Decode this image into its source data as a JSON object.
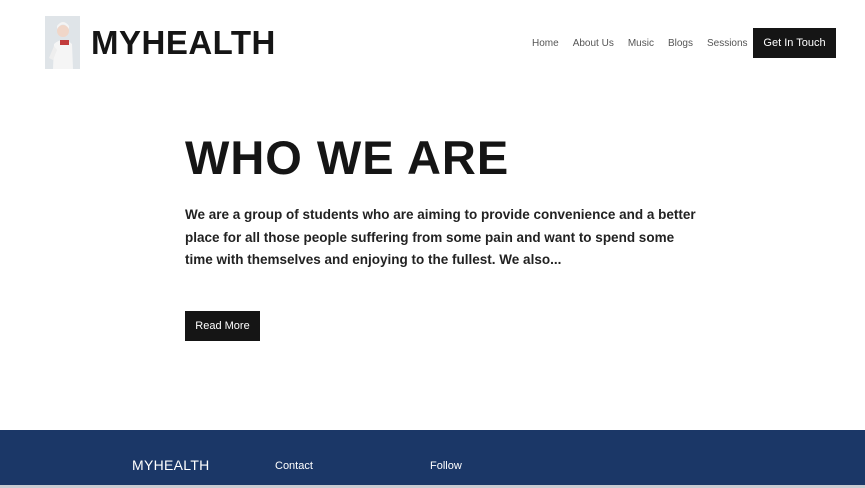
{
  "header": {
    "logo_icon": "person-photo",
    "title": "MYHEALTH",
    "nav": [
      "Home",
      "About Us",
      "Music",
      "Blogs",
      "Sessions"
    ],
    "cta_label": "Get In Touch"
  },
  "hero": {
    "title": "WHO WE ARE",
    "text": "We are a group of students who are aiming to provide convenience and a better place for all those people suffering from some pain and want to spend some time with themselves and enjoying to the fullest. We also...",
    "button_label": "Read More"
  },
  "footer": {
    "brand": "MYHEALTH",
    "contact_label": "Contact",
    "follow_label": "Follow",
    "background": "#1b3767"
  }
}
